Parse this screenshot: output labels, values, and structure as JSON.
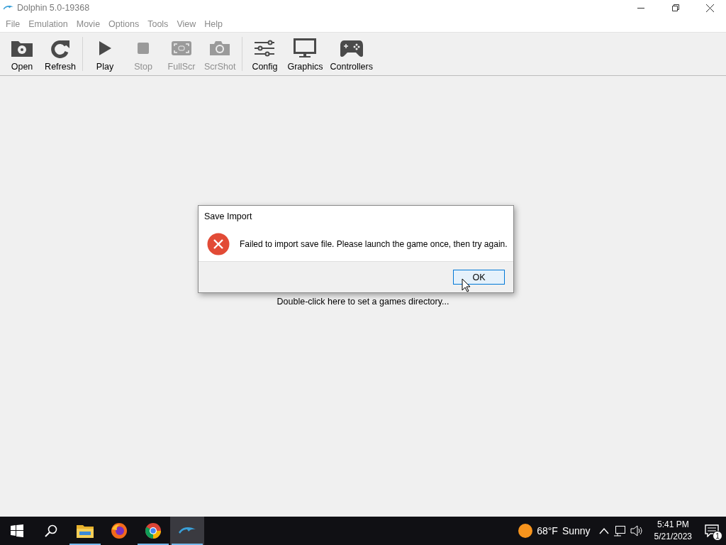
{
  "window": {
    "title": "Dolphin 5.0-19368",
    "active": false
  },
  "menu": [
    {
      "label": "File"
    },
    {
      "label": "Emulation"
    },
    {
      "label": "Movie"
    },
    {
      "label": "Options"
    },
    {
      "label": "Tools"
    },
    {
      "label": "View"
    },
    {
      "label": "Help"
    }
  ],
  "toolbar": [
    {
      "kind": "open",
      "label": "Open",
      "disabled": false,
      "separator_before": false
    },
    {
      "kind": "refresh",
      "label": "Refresh",
      "disabled": false,
      "separator_before": false
    },
    {
      "kind": "play",
      "label": "Play",
      "disabled": false,
      "separator_before": true
    },
    {
      "kind": "stop",
      "label": "Stop",
      "disabled": true,
      "separator_before": false
    },
    {
      "kind": "fullscr",
      "label": "FullScr",
      "disabled": true,
      "separator_before": false
    },
    {
      "kind": "scrshot",
      "label": "ScrShot",
      "disabled": true,
      "separator_before": false
    },
    {
      "kind": "config",
      "label": "Config",
      "disabled": false,
      "separator_before": true
    },
    {
      "kind": "graphics",
      "label": "Graphics",
      "disabled": false,
      "separator_before": false
    },
    {
      "kind": "controllers",
      "label": "Controllers",
      "disabled": false,
      "separator_before": false
    }
  ],
  "game_list": {
    "hint": "Double-click here to set a games directory..."
  },
  "dialog": {
    "title": "Save Import",
    "message": "Failed to import save file. Please launch the game once, then try again.",
    "buttons": [
      {
        "label": "OK",
        "focused": true
      }
    ]
  },
  "taskbar": {
    "apps": [
      {
        "kind": "start",
        "running": false,
        "active": false
      },
      {
        "kind": "search",
        "running": false,
        "active": false
      },
      {
        "kind": "explorer",
        "running": true,
        "active": false
      },
      {
        "kind": "firefox",
        "running": false,
        "active": false
      },
      {
        "kind": "chrome",
        "running": true,
        "active": false
      },
      {
        "kind": "dolphin",
        "running": true,
        "active": true
      }
    ],
    "weather": {
      "temperature": "68°F",
      "condition": "Sunny"
    },
    "time": "5:41 PM",
    "date": "5/21/2023",
    "notifications": "1"
  }
}
